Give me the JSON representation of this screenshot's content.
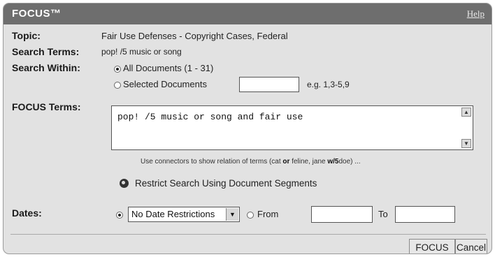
{
  "title": "FOCUS™",
  "help_link": "Help",
  "topic": {
    "label": "Topic:",
    "value": "Fair Use Defenses - Copyright Cases, Federal"
  },
  "search_terms": {
    "label": "Search Terms:",
    "value": "pop! /5 music or song"
  },
  "search_within": {
    "label": "Search Within:",
    "all_option": "All Documents (1 - 31)",
    "selected_option": "Selected Documents",
    "selected_value": "",
    "example": "e.g. 1,3-5,9"
  },
  "focus_terms": {
    "label": "FOCUS Terms:",
    "value": "pop! /5 music or song and fair use",
    "hint_prefix": "Use connectors to show relation of terms (cat ",
    "hint_or": "or",
    "hint_middle": " feline, jane ",
    "hint_w5": "w/5",
    "hint_suffix": "doe) ..."
  },
  "restrict_segments": "Restrict Search Using Document Segments",
  "dates": {
    "label": "Dates:",
    "select_value": "No Date Restrictions",
    "from_label": "From",
    "from_value": "",
    "to_label": "To",
    "to_value": ""
  },
  "buttons": {
    "focus": "FOCUS",
    "cancel": "Cancel"
  }
}
